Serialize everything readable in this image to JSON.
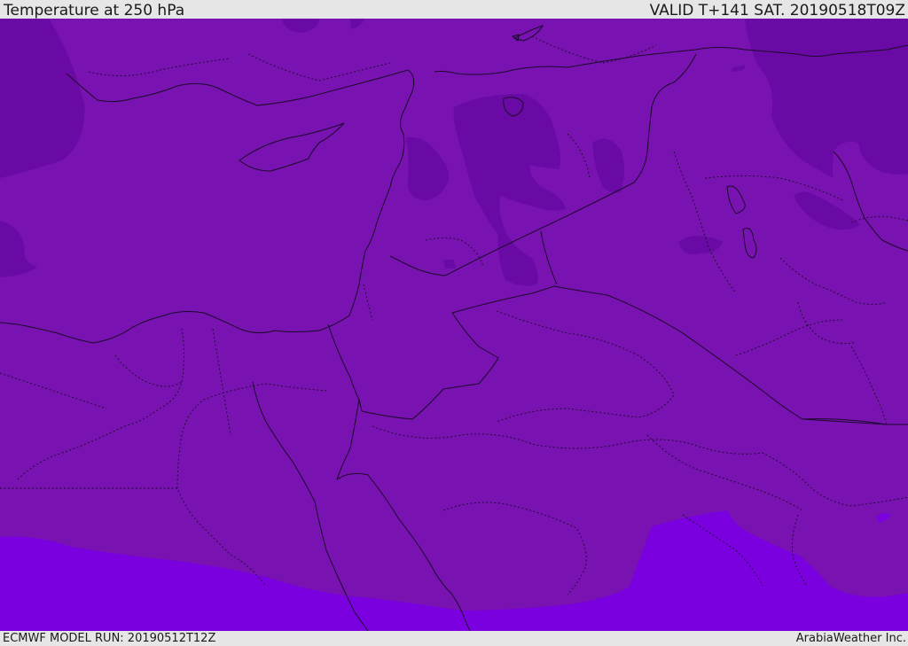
{
  "header": {
    "title": "Temperature at 250 hPa",
    "valid_time": "VALID T+141 SAT. 20190518T09Z"
  },
  "footer": {
    "model_run": "ECMWF MODEL RUN: 20190512T12Z",
    "credit": "ArabiaWeather Inc."
  },
  "map": {
    "colors": {
      "base_band": "#7812b0",
      "cold_band": "#6a0aa4",
      "warm_band": "#7b00df",
      "border_line": "#1a0a2a"
    }
  }
}
